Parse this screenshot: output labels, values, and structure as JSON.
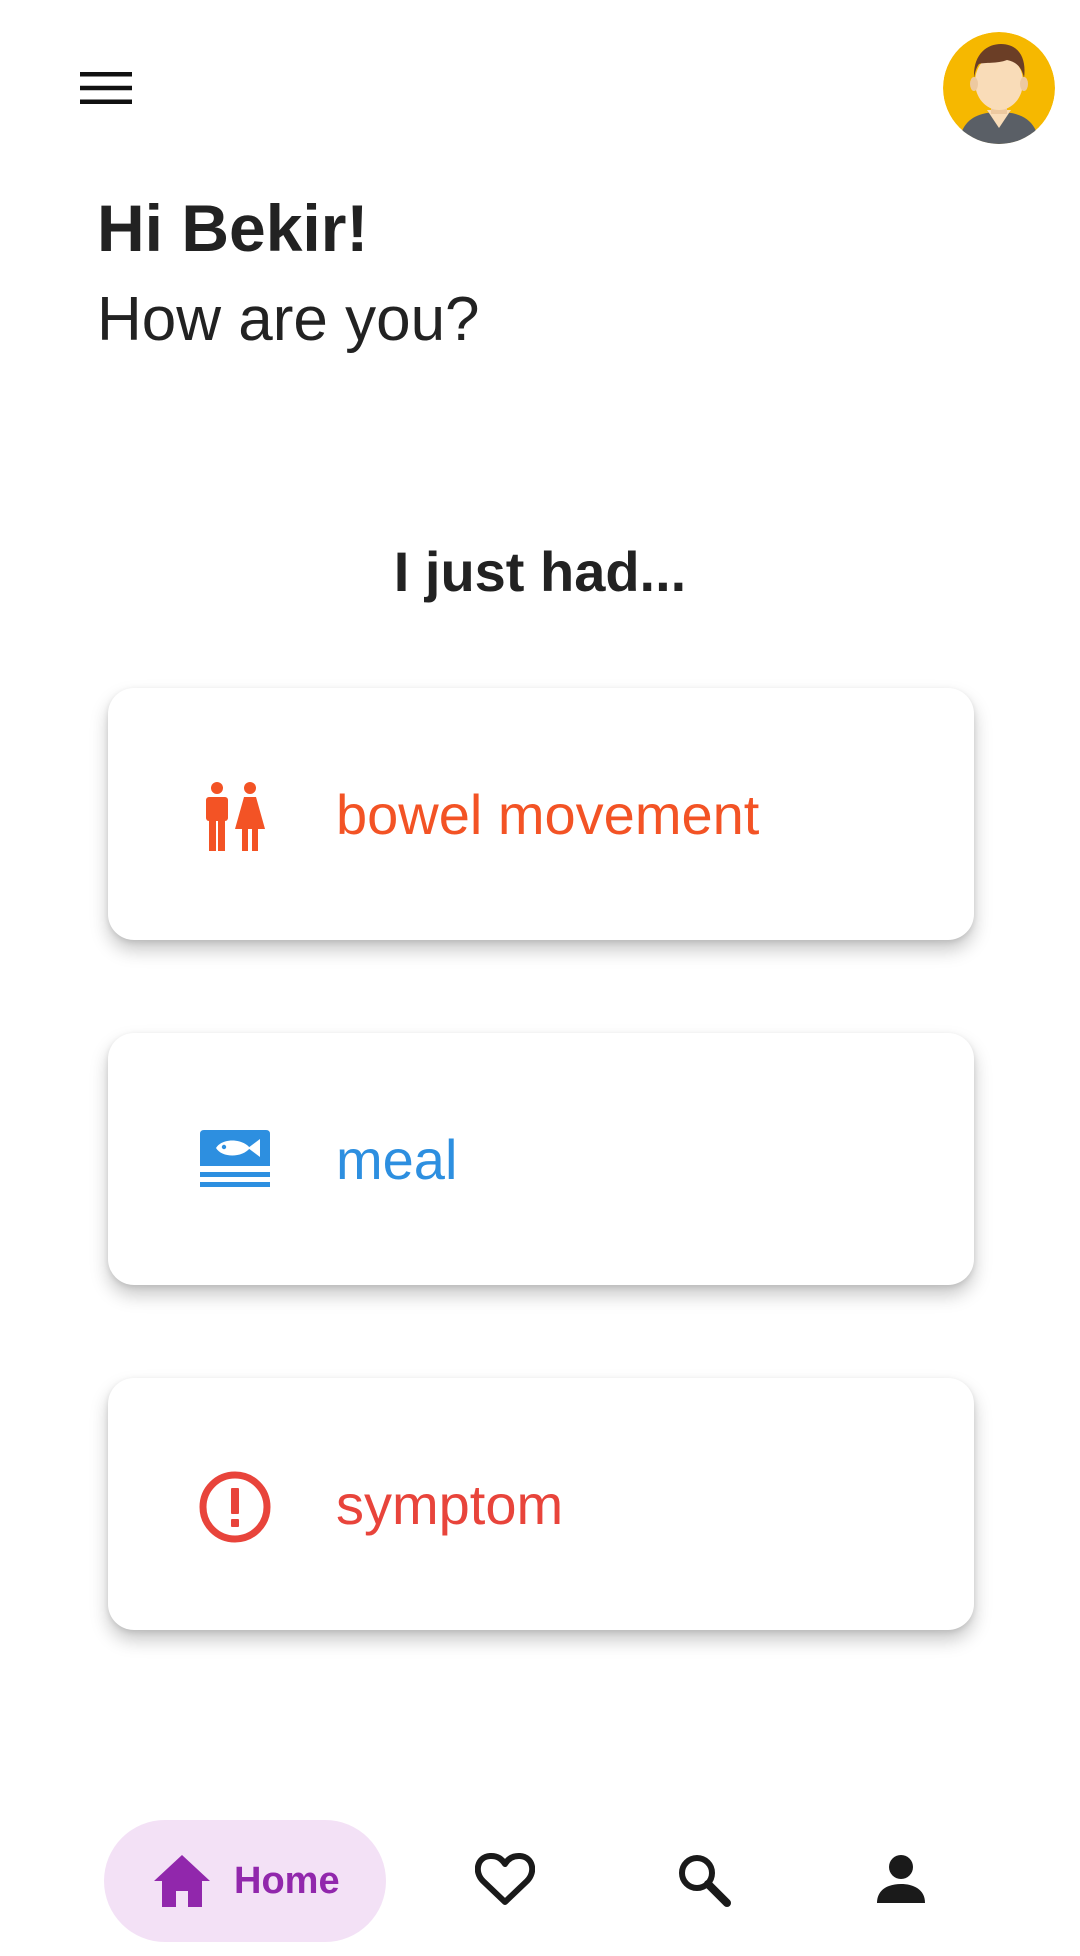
{
  "header": {
    "menu_icon": "menu-icon",
    "avatar_icon": "avatar-icon"
  },
  "greeting": {
    "title": "Hi Bekir!",
    "subtitle": "How are you?"
  },
  "section": {
    "title": "I just had..."
  },
  "cards": [
    {
      "label": "bowel movement",
      "icon": "restroom-icon",
      "color": "#f35325"
    },
    {
      "label": "meal",
      "icon": "meal-icon",
      "color": "#2d8fe0"
    },
    {
      "label": "symptom",
      "icon": "alert-circle-icon",
      "color": "#e8443b"
    }
  ],
  "bottom_nav": {
    "active_color": "#9127ac",
    "active_bg": "#f3e1f6",
    "items": [
      {
        "label": "Home",
        "icon": "home-icon",
        "active": true
      },
      {
        "icon": "heart-icon",
        "active": false
      },
      {
        "icon": "search-icon",
        "active": false
      },
      {
        "icon": "person-icon",
        "active": false
      }
    ]
  }
}
